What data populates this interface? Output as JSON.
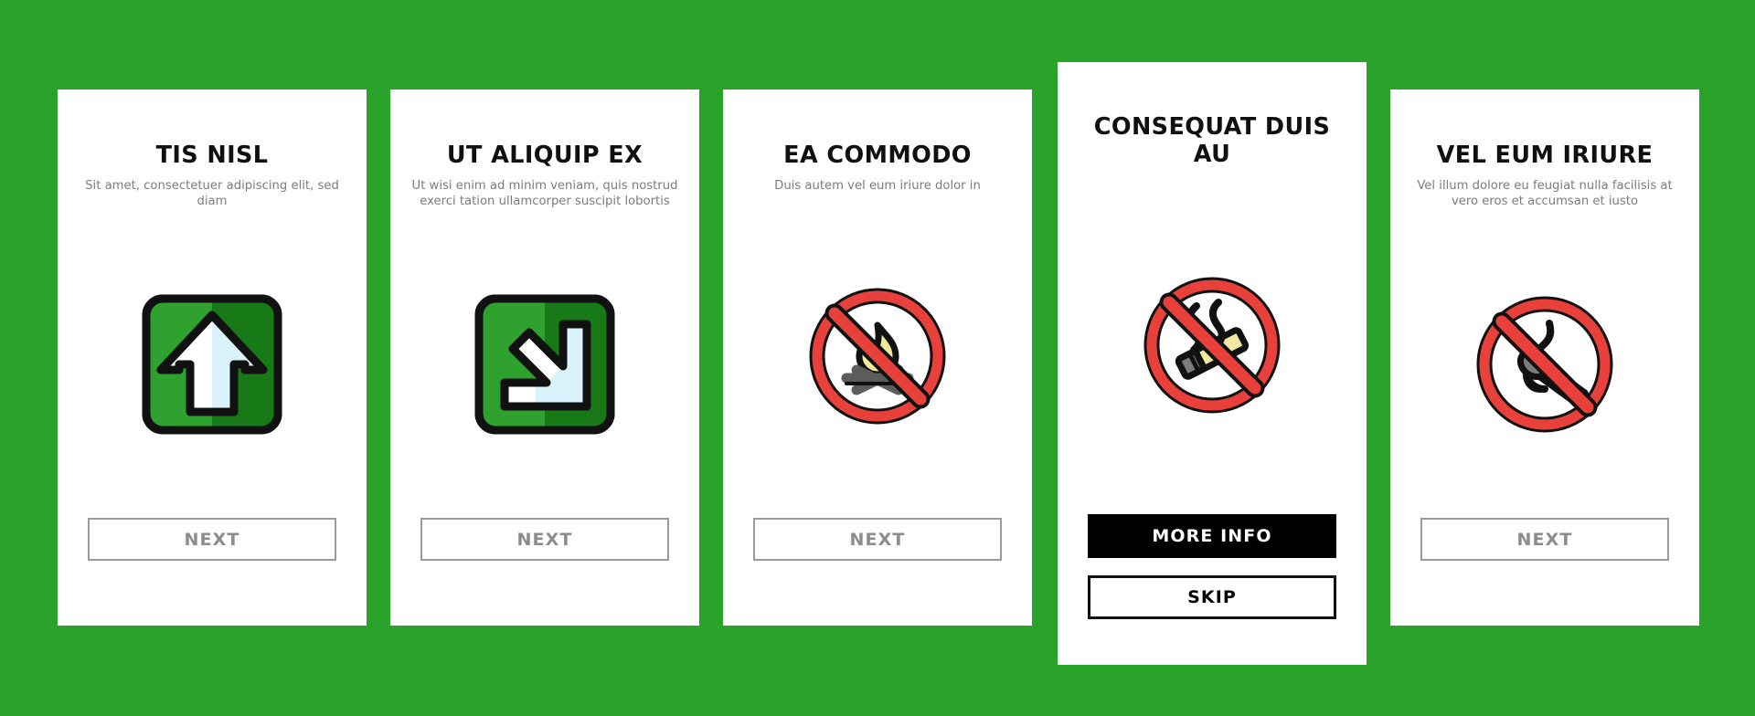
{
  "theme": {
    "background_color": "#29a329",
    "card_color": "#ffffff",
    "title_color": "#101010",
    "subtitle_color": "#7c7c7c",
    "next_button_text_color": "#8c8c8c",
    "next_button_border_color": "#9a9a9a",
    "primary_button_color": "#000000",
    "sign_green_light": "#2fa12f",
    "sign_green_dark": "#177a17",
    "prohibition_red": "#e8413c",
    "flame_yellow": "#f2e9a0",
    "log_gray": "#5c5c5c"
  },
  "cards": [
    {
      "id": "card-1",
      "state": "standard",
      "title": "TIS NISL",
      "subtitle": "Sit amet, consectetuer adipiscing elit, sed diam",
      "icon": "emergency-exit-up-arrow-sign-icon",
      "buttons": [
        {
          "id": "next",
          "label": "NEXT",
          "style": "outline"
        }
      ]
    },
    {
      "id": "card-2",
      "state": "standard",
      "title": "UT ALIQUIP EX",
      "subtitle": "Ut wisi enim ad minim veniam, quis nostrud exerci tation ullamcorper suscipit lobortis",
      "icon": "emergency-exit-diagonal-arrow-sign-icon",
      "buttons": [
        {
          "id": "next",
          "label": "NEXT",
          "style": "outline"
        }
      ]
    },
    {
      "id": "card-3",
      "state": "standard",
      "title": "EA COMMODO",
      "subtitle": "Duis autem vel eum iriure dolor in",
      "icon": "no-campfire-prohibition-icon",
      "buttons": [
        {
          "id": "next",
          "label": "NEXT",
          "style": "outline"
        }
      ]
    },
    {
      "id": "card-4",
      "state": "featured",
      "title": "CONSEQUAT DUIS AU",
      "subtitle": "",
      "icon": "no-smoking-prohibition-icon",
      "buttons": [
        {
          "id": "more-info",
          "label": "MORE INFO",
          "style": "filled"
        },
        {
          "id": "skip",
          "label": "SKIP",
          "style": "bordered"
        }
      ]
    },
    {
      "id": "card-5",
      "state": "standard",
      "title": "VEL EUM IRIURE",
      "subtitle": "Vel illum dolore eu feugiat nulla facilisis at vero eros et accumsan et iusto",
      "icon": "no-matches-prohibition-icon",
      "buttons": [
        {
          "id": "next",
          "label": "NEXT",
          "style": "outline"
        }
      ]
    }
  ]
}
